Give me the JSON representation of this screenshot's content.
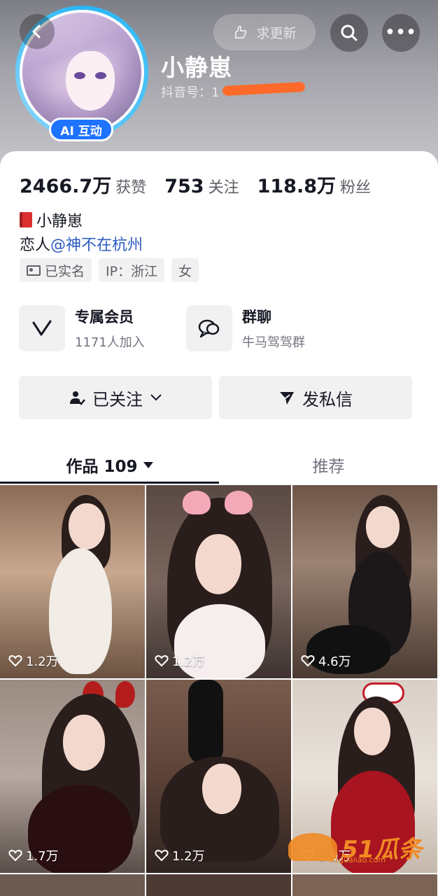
{
  "header": {
    "nickname": "小静崽",
    "douyin_id_label": "抖音号：1",
    "ai_badge": "AI 互动",
    "update_button": "求更新"
  },
  "stats": [
    {
      "value": "2466.7万",
      "label": "获赞"
    },
    {
      "value": "753",
      "label": "关注"
    },
    {
      "value": "118.8万",
      "label": "粉丝"
    }
  ],
  "bio": {
    "line1": "小静崽",
    "line2_prefix": "恋人",
    "line2_mention": "@神不在杭州"
  },
  "tags": [
    "已实名",
    "IP：浙江",
    "女"
  ],
  "features": [
    {
      "title": "专属会员",
      "subtitle": "1171人加入",
      "icon": "vip-v-icon"
    },
    {
      "title": "群聊",
      "subtitle": "牛马驾驾群",
      "icon": "chat-bubbles-icon"
    }
  ],
  "actions": {
    "followed": "已关注",
    "message": "发私信"
  },
  "tabs": {
    "works": "作品 109",
    "recommend": "推荐"
  },
  "grid": [
    {
      "likes": "1.2万"
    },
    {
      "likes": "1.2万"
    },
    {
      "likes": "4.6万"
    },
    {
      "likes": "1.7万"
    },
    {
      "likes": "1.2万"
    },
    {
      "likes": "1.9万"
    }
  ],
  "watermark": {
    "brand": "51瓜条",
    "sub": "51gualiao.com"
  },
  "colors": {
    "accent_blue": "#1e73ff",
    "mention_blue": "#2c5bbf",
    "watermark_orange": "#f08a24"
  }
}
